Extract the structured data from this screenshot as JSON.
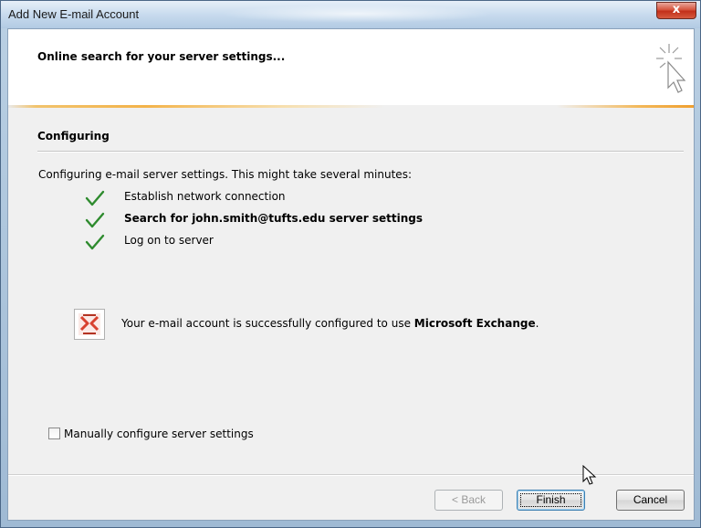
{
  "window": {
    "title": "Add New E-mail Account",
    "close_glyph": "x"
  },
  "header": {
    "title": "Online search for your server settings...",
    "icon": "wizard-cursor-sparkle-icon"
  },
  "section": {
    "title": "Configuring",
    "intro": "Configuring e-mail server settings. This might take several minutes:"
  },
  "steps": [
    {
      "label": "Establish network connection",
      "status": "done",
      "bold": false
    },
    {
      "label": "Search for john.smith@tufts.edu server settings",
      "status": "done",
      "bold": true
    },
    {
      "label": "Log on to server",
      "status": "done",
      "bold": false
    }
  ],
  "result": {
    "icon": "exchange-icon",
    "text_prefix": "Your e-mail account is successfully configured to use ",
    "text_bold": "Microsoft Exchange",
    "text_suffix": "."
  },
  "manual_config": {
    "label": "Manually configure server settings",
    "checked": false
  },
  "buttons": {
    "back": "< Back",
    "finish": "Finish",
    "cancel": "Cancel"
  },
  "colors": {
    "check_green": "#2e8b2e",
    "exchange_red": "#d8412f",
    "header_accent": "#f3b34a"
  }
}
